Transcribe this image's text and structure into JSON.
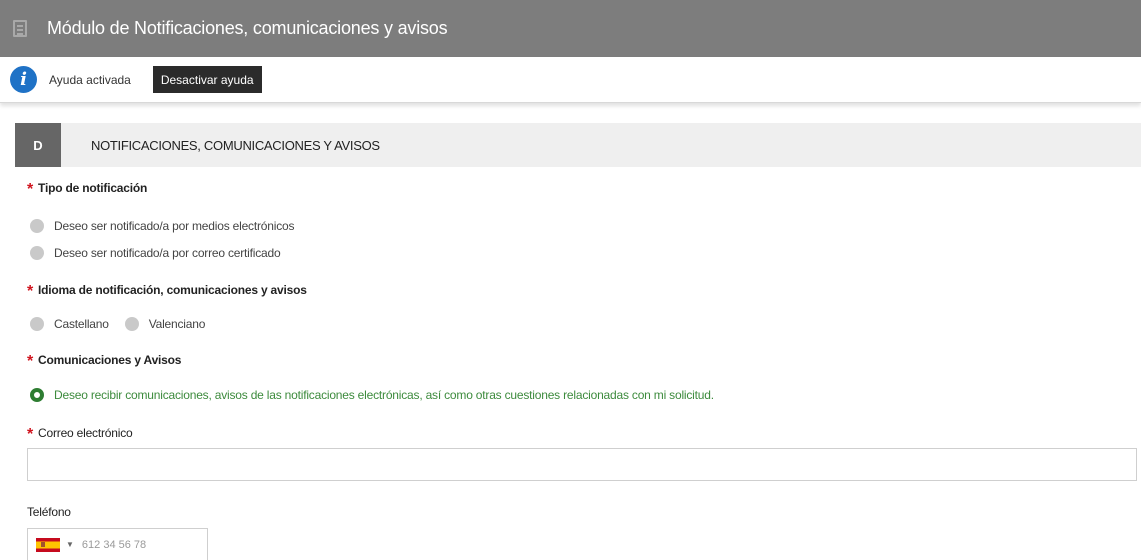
{
  "header": {
    "title": "Módulo de Notificaciones, comunicaciones y avisos"
  },
  "help": {
    "status": "Ayuda activada",
    "button": "Desactivar ayuda"
  },
  "section": {
    "letter": "D",
    "title": "NOTIFICACIONES, COMUNICACIONES Y AVISOS"
  },
  "notification_type": {
    "label": "Tipo de notificación",
    "options": [
      "Deseo ser notificado/a por medios electrónicos",
      "Deseo ser notificado/a por correo certificado"
    ]
  },
  "language": {
    "label": "Idioma de notificación, comunicaciones y avisos",
    "options": [
      "Castellano",
      "Valenciano"
    ]
  },
  "communications": {
    "label": "Comunicaciones y Avisos",
    "option": "Deseo recibir comunicaciones, avisos de las notificaciones electrónicas, así como otras cuestiones relacionadas con mi solicitud."
  },
  "email": {
    "label": "Correo electrónico",
    "value": ""
  },
  "phone": {
    "label": "Teléfono",
    "placeholder": "612 34 56 78",
    "country": "spain-flag-icon"
  },
  "colors": {
    "required": "#d0141e",
    "selected": "#2e7d32",
    "header_bg": "#7d7d7d",
    "info": "#1f72c6"
  }
}
